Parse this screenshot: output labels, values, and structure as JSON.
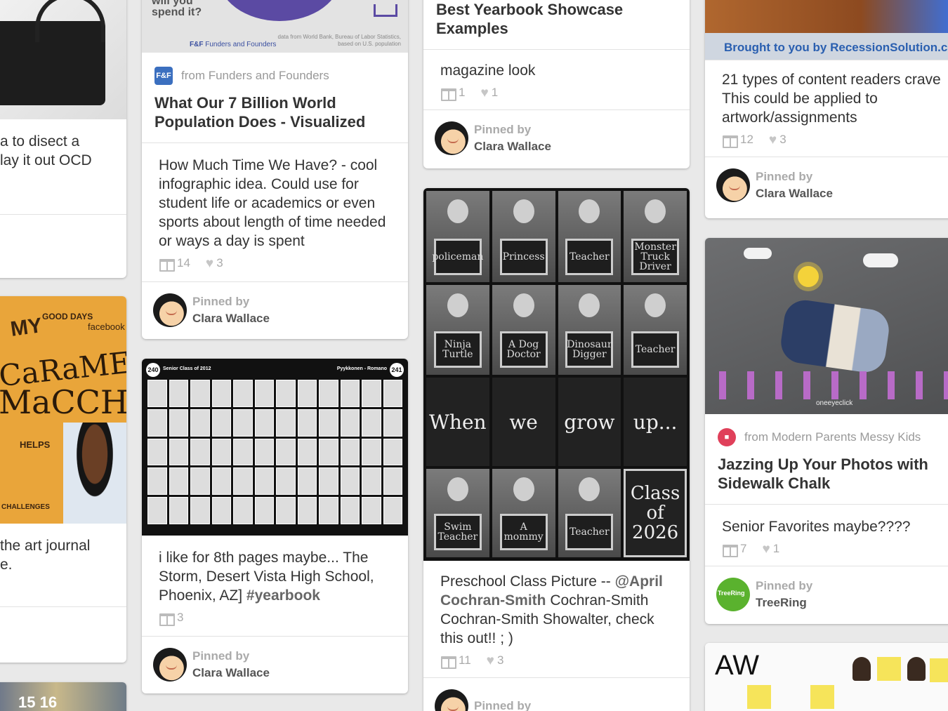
{
  "colors": {
    "background": "#e9e9e9",
    "card": "#ffffff",
    "muted": "#aaaaaa",
    "link": "#666666"
  },
  "col1": {
    "text_a": [
      "a to disect a",
      "lay it out OCD"
    ],
    "caramel": {
      "line1": "MY",
      "line2": "CaRaMEL",
      "line3": "MaCCHiaTO",
      "good_days": "GOOD DAYS",
      "facebook": "facebook",
      "helps": "HELPS",
      "challenges": "CHALLENGES"
    },
    "text_b": [
      "the art journal",
      "e."
    ]
  },
  "card1": {
    "image": {
      "q1": "will you",
      "q2": "spend it?",
      "brand": "Funders and Founders",
      "note1": "data from World Bank, Bureau of Labor Statistics,",
      "note2": "based on U.S. population"
    },
    "source": "from Funders and Founders",
    "source_icon": "F&F",
    "title": "What Our 7 Billion World Population Does - Visualized",
    "description": "How Much Time We Have? - cool infographic idea. Could use for student life or academics or even sports about length of time needed or ways a day is spent",
    "repins": "14",
    "likes": "3",
    "pinned_by": "Pinned by",
    "pinner": "Clara Wallace"
  },
  "card2": {
    "image": {
      "left_page": "240",
      "left_label": "Senior Class of 2012",
      "right_label": "Pyykkonen - Romano",
      "right_page": "241"
    },
    "description_pre": "i like for 8th pages maybe... The Storm, Desert Vista High School, Phoenix, AZ] ",
    "hashtag": "#yearbook",
    "repins": "3",
    "pinned_by": "Pinned by",
    "pinner": "Clara Wallace"
  },
  "card3": {
    "title": "Best Yearbook Showcase Examples",
    "description": "magazine look",
    "repins": "1",
    "likes": "1",
    "pinned_by": "Pinned by",
    "pinner": "Clara Wallace"
  },
  "card4": {
    "row1": [
      "policeman",
      "Princess",
      "Teacher",
      "Monster Truck Driver"
    ],
    "row2": [
      "Ninja Turtle",
      "A Dog Doctor",
      "Dinosaur Digger",
      "Teacher"
    ],
    "row3": [
      "When",
      "we",
      "grow",
      "up..."
    ],
    "row4": [
      "Swim Teacher",
      "A mommy",
      "Teacher"
    ],
    "class_of": "Class of 2026",
    "desc_pre": "Preschool Class Picture -- ",
    "mention": "@April Cochran-Smith",
    "desc_post": " Cochran-Smith Cochran-Smith Showalter, check this out!! ; )",
    "repins": "11",
    "likes": "3",
    "pinned_by": "Pinned by"
  },
  "card5": {
    "image_caption": "Brought to you by RecessionSolution.com",
    "description": "21 types of content readers crave This could be applied to artwork/assignments",
    "repins": "12",
    "likes": "3",
    "pinned_by": "Pinned by",
    "pinner": "Clara Wallace"
  },
  "card6": {
    "watermark": "oneeyeclick",
    "source": "from Modern Parents Messy Kids",
    "title": "Jazzing Up Your Photos with Sidewalk Chalk",
    "description": "Senior Favorites maybe????",
    "repins": "7",
    "likes": "1",
    "pinned_by": "Pinned by",
    "pinner": "TreeRing"
  },
  "card7": {
    "heading": "AW"
  }
}
